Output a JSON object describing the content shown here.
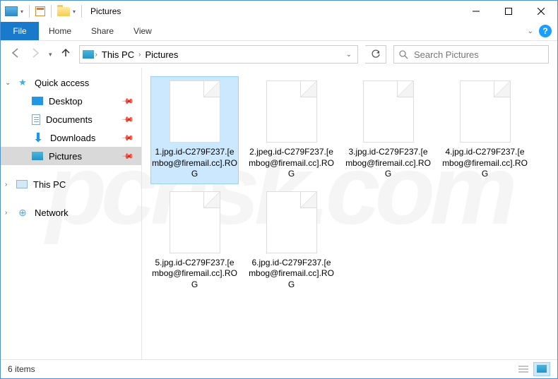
{
  "window": {
    "title": "Pictures"
  },
  "menubar": {
    "file": "File",
    "items": [
      "Home",
      "Share",
      "View"
    ]
  },
  "breadcrumb": {
    "root_icon": "pc",
    "parts": [
      "This PC",
      "Pictures"
    ]
  },
  "search": {
    "placeholder": "Search Pictures"
  },
  "sidebar": {
    "quick_access": {
      "label": "Quick access",
      "items": [
        {
          "label": "Desktop",
          "icon": "desktop",
          "pinned": true
        },
        {
          "label": "Documents",
          "icon": "doc",
          "pinned": true
        },
        {
          "label": "Downloads",
          "icon": "down",
          "pinned": true
        },
        {
          "label": "Pictures",
          "icon": "pics",
          "pinned": true,
          "selected": true
        }
      ]
    },
    "this_pc": {
      "label": "This PC"
    },
    "network": {
      "label": "Network"
    }
  },
  "files": [
    {
      "name": "1.jpg.id-C279F237.[embog@firemail.cc].ROG",
      "selected": true
    },
    {
      "name": "2.jpeg.id-C279F237.[embog@firemail.cc].ROG"
    },
    {
      "name": "3.jpg.id-C279F237.[embog@firemail.cc].ROG"
    },
    {
      "name": "4.jpg.id-C279F237.[embog@firemail.cc].ROG"
    },
    {
      "name": "5.jpg.id-C279F237.[embog@firemail.cc].ROG"
    },
    {
      "name": "6.jpg.id-C279F237.[embog@firemail.cc].ROG"
    }
  ],
  "statusbar": {
    "count_label": "6 items"
  },
  "watermark": "pcrisk.com"
}
